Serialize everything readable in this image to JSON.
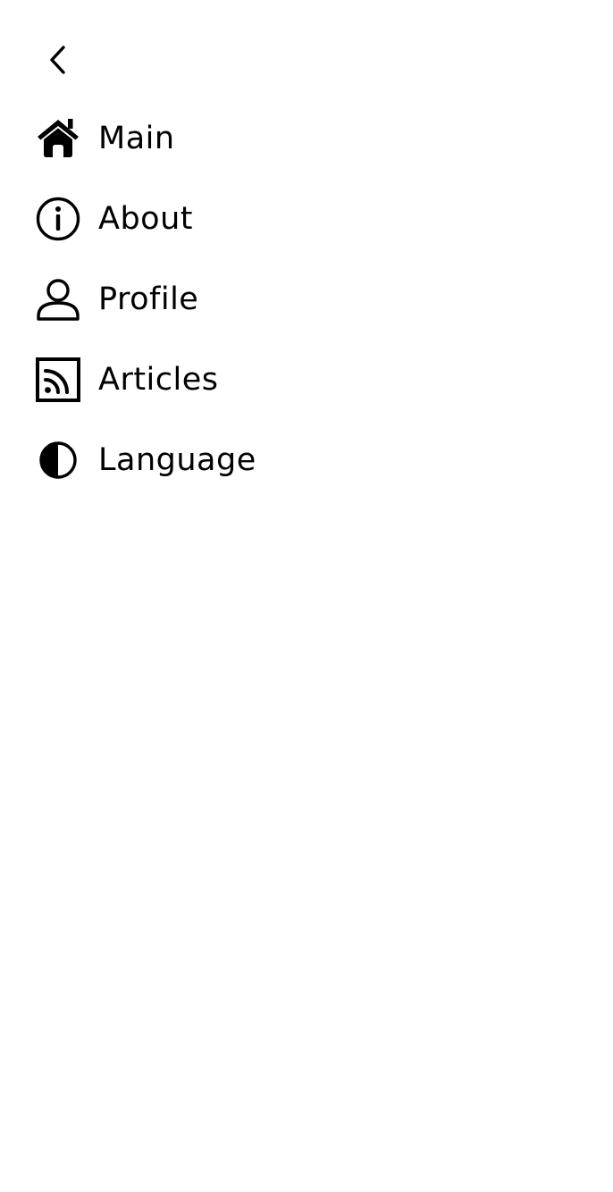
{
  "drawer": {
    "back_icon": "chevron-left-icon",
    "items": [
      {
        "label": "Main",
        "icon": "home-icon"
      },
      {
        "label": "About",
        "icon": "info-icon"
      },
      {
        "label": "Profile",
        "icon": "user-icon"
      },
      {
        "label": "Articles",
        "icon": "rss-icon"
      },
      {
        "label": "Language",
        "icon": "contrast-icon"
      }
    ]
  },
  "colors": {
    "background": "#ffffff",
    "foreground": "#000000"
  }
}
